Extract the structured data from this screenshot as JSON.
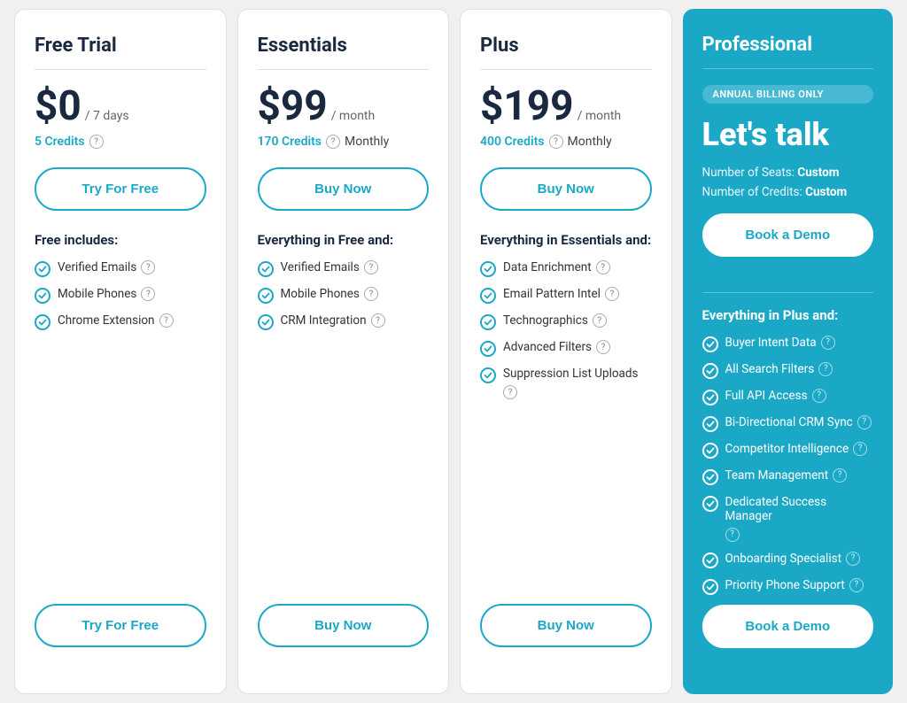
{
  "plans": [
    {
      "id": "free-trial",
      "title": "Free Trial",
      "price": "$0",
      "period": "/ 7 days",
      "credits": "5 Credits",
      "credits_suffix": "",
      "cta_top": "Try For Free",
      "cta_bottom": "Try For Free",
      "features_heading": "Free includes:",
      "features": [
        {
          "name": "Verified Emails",
          "has_question": true
        },
        {
          "name": "Mobile Phones",
          "has_question": true
        },
        {
          "name": "Chrome Extension",
          "has_question": true
        }
      ]
    },
    {
      "id": "essentials",
      "title": "Essentials",
      "price": "$99",
      "period": "/ month",
      "credits": "170 Credits",
      "credits_suffix": "Monthly",
      "cta_top": "Buy Now",
      "cta_bottom": "Buy Now",
      "features_heading": "Everything in Free and:",
      "features": [
        {
          "name": "Verified Emails",
          "has_question": true
        },
        {
          "name": "Mobile Phones",
          "has_question": true
        },
        {
          "name": "CRM Integration",
          "has_question": true
        }
      ]
    },
    {
      "id": "plus",
      "title": "Plus",
      "price": "$199",
      "period": "/ month",
      "credits": "400 Credits",
      "credits_suffix": "Monthly",
      "cta_top": "Buy Now",
      "cta_bottom": "Buy Now",
      "features_heading": "Everything in Essentials and:",
      "features": [
        {
          "name": "Data Enrichment",
          "has_question": true
        },
        {
          "name": "Email Pattern Intel",
          "has_question": true
        },
        {
          "name": "Technographics",
          "has_question": true
        },
        {
          "name": "Advanced Filters",
          "has_question": true
        },
        {
          "name": "Suppression List Uploads",
          "has_question": true
        }
      ]
    }
  ],
  "professional": {
    "title": "Professional",
    "annual_badge": "ANNUAL BILLING ONLY",
    "lets_talk": "Let's talk",
    "seats_label": "Number of Seats:",
    "seats_value": "Custom",
    "credits_label": "Number of Credits:",
    "credits_value": "Custom",
    "cta_top": "Book a Demo",
    "cta_bottom": "Book a Demo",
    "features_heading": "Everything in Plus and:",
    "features": [
      {
        "name": "Buyer Intent Data",
        "has_question": true
      },
      {
        "name": "All Search Filters",
        "has_question": true
      },
      {
        "name": "Full API Access",
        "has_question": true
      },
      {
        "name": "Bi-Directional CRM Sync",
        "has_question": true
      },
      {
        "name": "Competitor Intelligence",
        "has_question": true
      },
      {
        "name": "Team Management",
        "has_question": true
      },
      {
        "name": "Dedicated Success Manager",
        "has_question": true
      },
      {
        "name": "Onboarding Specialist",
        "has_question": true
      },
      {
        "name": "Priority Phone Support",
        "has_question": true
      }
    ]
  }
}
